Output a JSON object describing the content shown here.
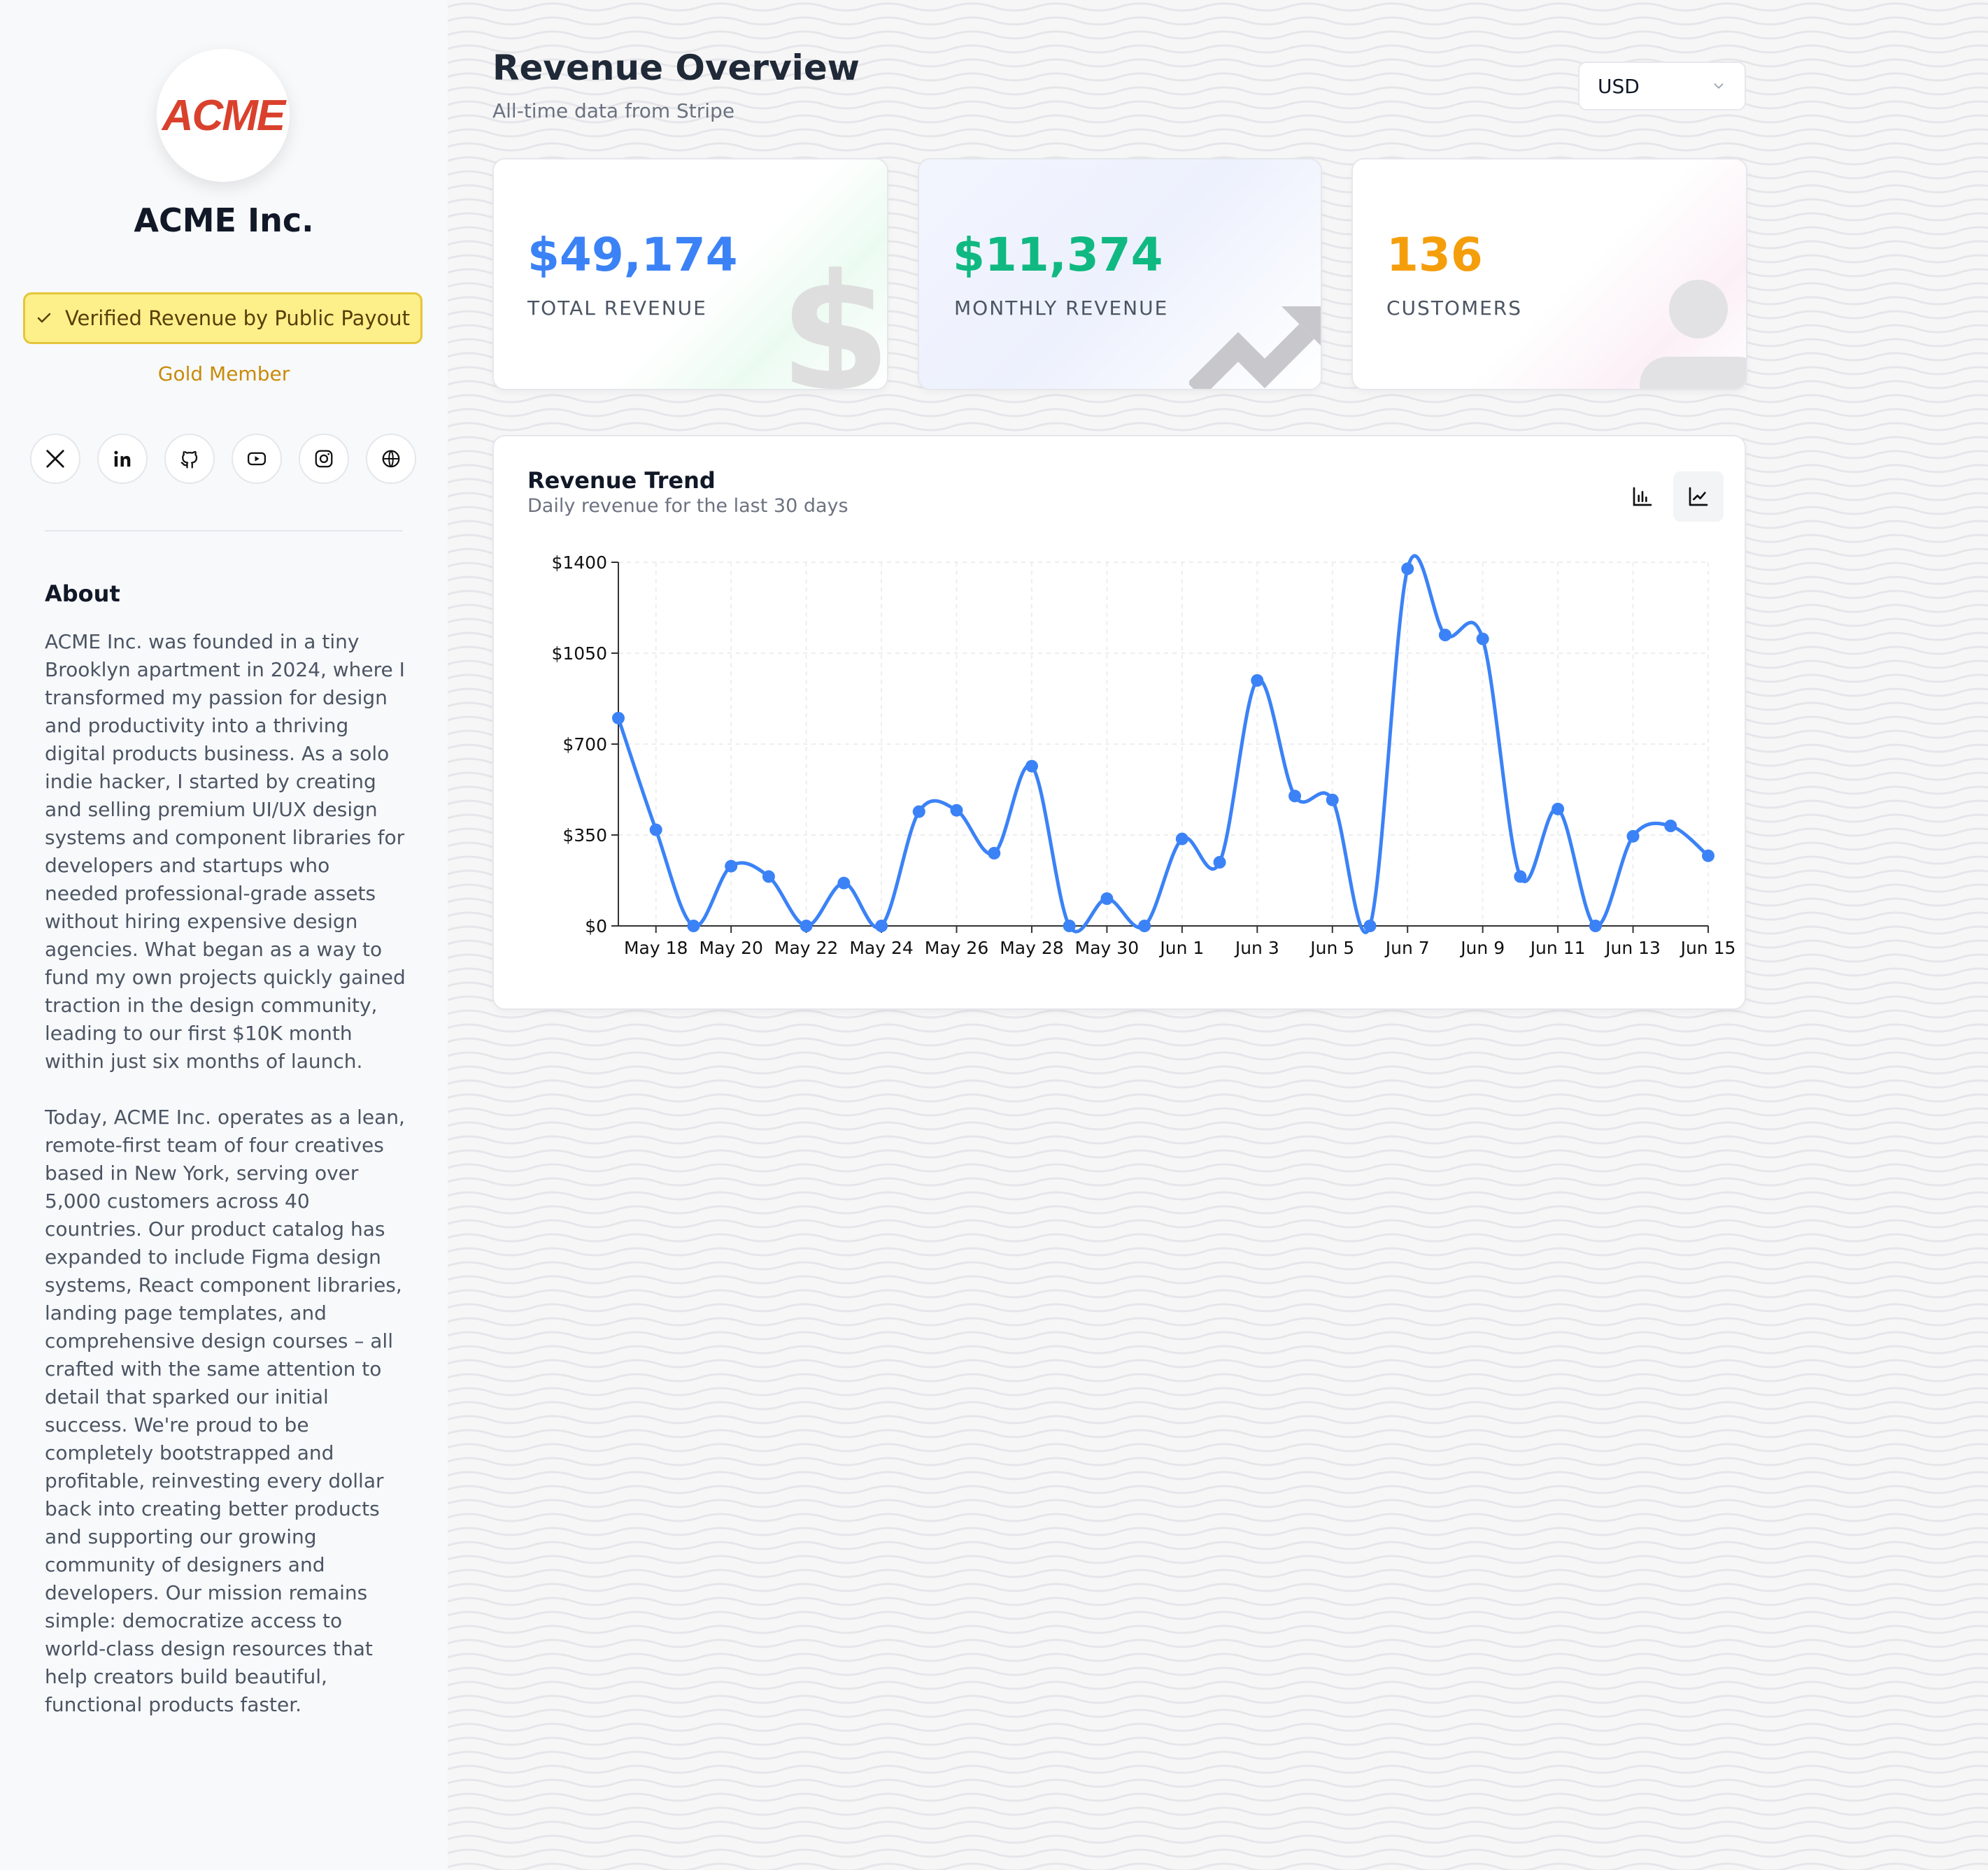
{
  "profile": {
    "logo_text": "ACME",
    "company": "ACME Inc.",
    "verified_label": "Verified Revenue by Public Payout",
    "membership": "Gold Member",
    "socials": [
      "x-icon",
      "linkedin-icon",
      "github-icon",
      "youtube-icon",
      "instagram-icon",
      "globe-icon"
    ],
    "about_title": "About",
    "about_paragraphs": [
      "ACME Inc. was founded in a tiny Brooklyn apartment in 2024, where I transformed my passion for design and productivity into a thriving digital products business. As a solo indie hacker, I started by creating and selling premium UI/UX design systems and component libraries for developers and startups who needed professional-grade assets without hiring expensive design agencies. What began as a way to fund my own projects quickly gained traction in the design community, leading to our first $10K month within just six months of launch.",
      "Today, ACME Inc. operates as a lean, remote-first team of four creatives based in New York, serving over 5,000 customers across 40 countries. Our product catalog has expanded to include Figma design systems, React component libraries, landing page templates, and comprehensive design courses – all crafted with the same attention to detail that sparked our initial success. We're proud to be completely bootstrapped and profitable, reinvesting every dollar back into creating better products and supporting our growing community of designers and developers. Our mission remains simple: democratize access to world-class design resources that help creators build beautiful, functional products faster."
    ]
  },
  "header": {
    "title": "Revenue Overview",
    "subtitle": "All-time data from Stripe",
    "currency": "USD"
  },
  "stats": {
    "total": {
      "value": "$49,174",
      "label": "TOTAL REVENUE",
      "color": "#3b82f6"
    },
    "monthly": {
      "value": "$11,374",
      "label": "MONTHLY REVENUE",
      "color": "#10b981"
    },
    "customers": {
      "value": "136",
      "label": "CUSTOMERS",
      "color": "#f59e0b"
    }
  },
  "trend": {
    "title": "Revenue Trend",
    "subtitle": "Daily revenue for the last 30 days"
  },
  "chart_data": {
    "type": "line",
    "x": [
      "May 17",
      "May 18",
      "May 19",
      "May 20",
      "May 21",
      "May 22",
      "May 23",
      "May 24",
      "May 25",
      "May 26",
      "May 27",
      "May 28",
      "May 29",
      "May 30",
      "May 31",
      "Jun 1",
      "Jun 2",
      "Jun 3",
      "Jun 4",
      "Jun 5",
      "Jun 6",
      "Jun 7",
      "Jun 8",
      "Jun 9",
      "Jun 10",
      "Jun 11",
      "Jun 12",
      "Jun 13",
      "Jun 14",
      "Jun 15"
    ],
    "series": [
      {
        "values": [
          800,
          370,
          0,
          230,
          190,
          0,
          165,
          0,
          440,
          445,
          280,
          615,
          0,
          105,
          0,
          335,
          245,
          945,
          500,
          485,
          0,
          1375,
          1120,
          1105,
          190,
          450,
          0,
          345,
          385,
          270
        ]
      }
    ],
    "tick_labels": [
      "May 18",
      "May 20",
      "May 22",
      "May 24",
      "May 26",
      "May 28",
      "May 30",
      "Jun 1",
      "Jun 3",
      "Jun 5",
      "Jun 7",
      "Jun 9",
      "Jun 11",
      "Jun 13",
      "Jun 15"
    ],
    "y_ticks": [
      "$0",
      "$350",
      "$700",
      "$1050",
      "$1400"
    ],
    "ylim": [
      0,
      1400
    ],
    "grid": true,
    "color": "#3b82f6"
  }
}
